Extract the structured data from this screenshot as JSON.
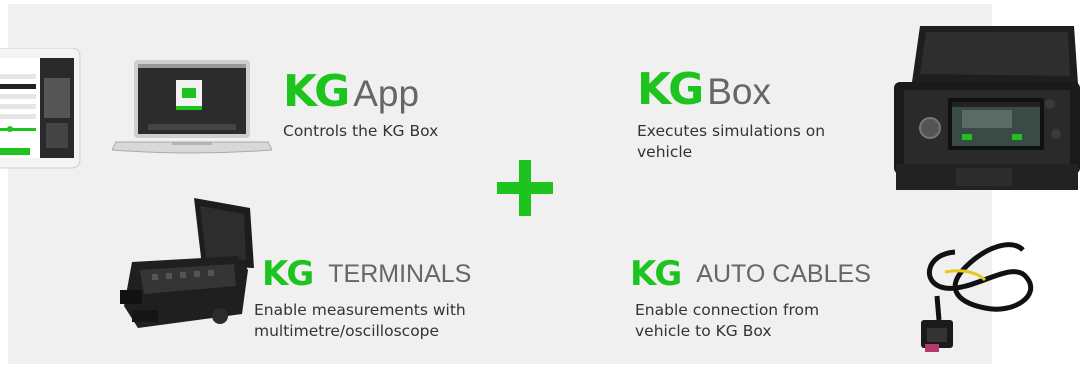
{
  "app": {
    "kg": "KG",
    "name": "App",
    "desc": "Controls the KG Box"
  },
  "box": {
    "kg": "KG",
    "name": "Box",
    "desc1": "Executes simulations on",
    "desc2": "vehicle"
  },
  "terminals": {
    "kg": "KG",
    "name": "TERMINALS",
    "desc1": "Enable measurements with",
    "desc2": "multimetre/oscilloscope"
  },
  "cables": {
    "kg": "KG",
    "name": "AUTO CABLES",
    "desc1": "Enable connection from",
    "desc2": "vehicle to KG Box"
  },
  "colors": {
    "accent": "#1ec41e",
    "panel": "#f0f0f0",
    "name_text": "#666666",
    "desc_text": "#333333"
  },
  "icons": [
    "phone-image",
    "laptop-image",
    "kg-box-image",
    "terminals-case-image",
    "auto-cable-image",
    "plus-icon"
  ]
}
